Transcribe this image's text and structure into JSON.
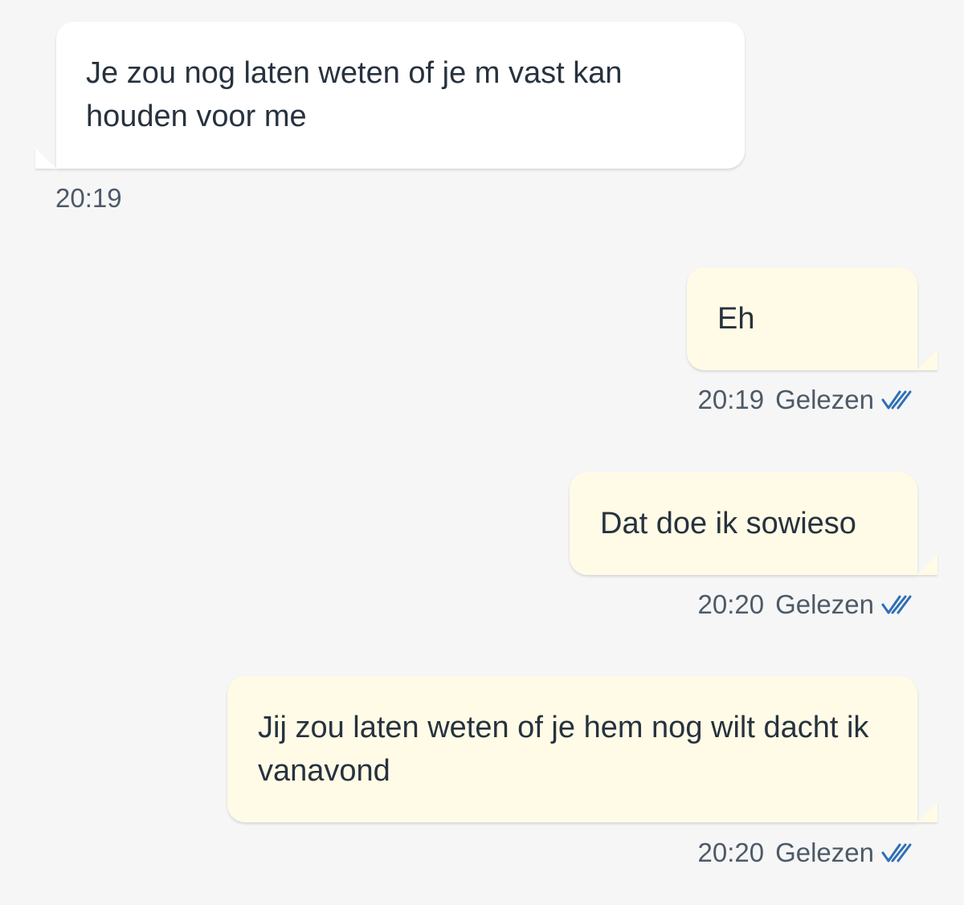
{
  "colors": {
    "background": "#f6f6f6",
    "incoming_bubble": "#ffffff",
    "outgoing_bubble": "#fffbe6",
    "text": "#27323f",
    "meta_text": "#4d5a68",
    "read_ticks": "#2f6fb6"
  },
  "messages": [
    {
      "direction": "incoming",
      "text": "Je zou nog laten weten of je m vast kan houden voor me",
      "time": "20:19"
    },
    {
      "direction": "outgoing",
      "text": "Eh",
      "time": "20:19",
      "status": "Gelezen",
      "status_icon": "double-check-icon"
    },
    {
      "direction": "outgoing",
      "text": "Dat doe ik sowieso",
      "time": "20:20",
      "status": "Gelezen",
      "status_icon": "double-check-icon"
    },
    {
      "direction": "outgoing",
      "text": "Jij zou laten weten of je hem nog wilt dacht ik vanavond",
      "time": "20:20",
      "status": "Gelezen",
      "status_icon": "double-check-icon"
    }
  ]
}
